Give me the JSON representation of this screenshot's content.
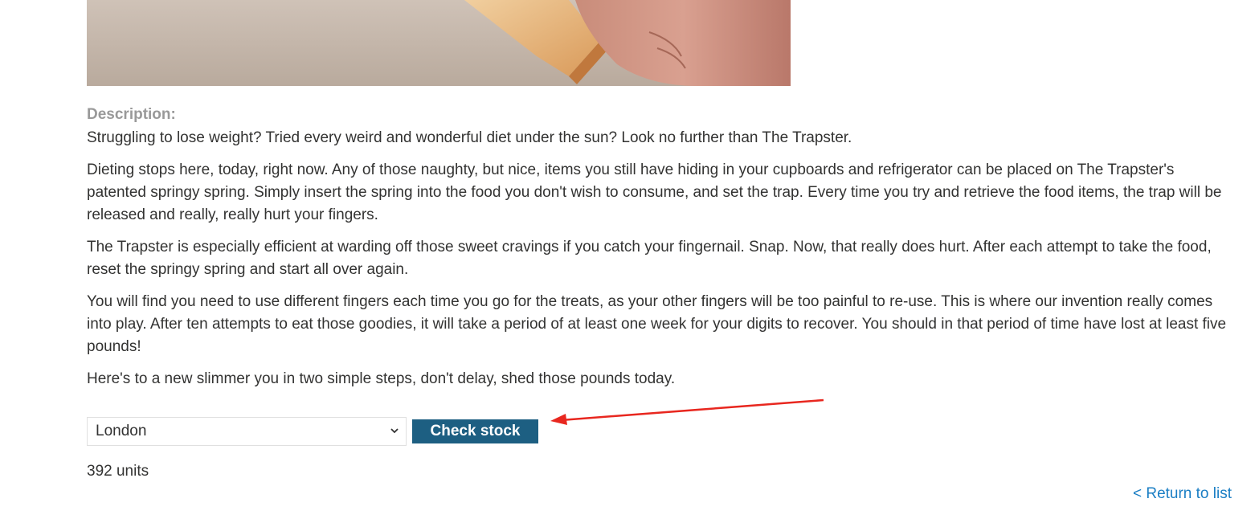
{
  "description": {
    "label": "Description:",
    "paragraphs": [
      "Struggling to lose weight? Tried every weird and wonderful diet under the sun? Look no further than The Trapster.",
      "Dieting stops here, today, right now. Any of those naughty, but nice, items you still have hiding in your cupboards and refrigerator can be placed on The Trapster's patented springy spring. Simply insert the spring into the food you don't wish to consume, and set the trap. Every time you try and retrieve the food items, the trap will be released and really, really hurt your fingers.",
      "The Trapster is especially efficient at warding off those sweet cravings if you catch your fingernail. Snap. Now, that really does hurt. After each attempt to take the food, reset the springy spring and start all over again.",
      "You will find you need to use different fingers each time you go for the treats, as your other fingers will be too painful to re-use. This is where our invention really comes into play. After ten attempts to eat those goodies, it will take a period of at least one week for your digits to recover. You should in that period of time have lost at least five pounds!",
      "Here's to a new slimmer you in two simple steps, don't delay, shed those pounds today."
    ]
  },
  "stock_check": {
    "selected_store": "London",
    "button_label": "Check stock",
    "result": "392 units"
  },
  "navigation": {
    "return_link": "< Return to list"
  },
  "colors": {
    "button_bg": "#1d5f82",
    "link": "#1a7ec4",
    "label_gray": "#999999",
    "annotation_arrow": "#e8271f"
  }
}
